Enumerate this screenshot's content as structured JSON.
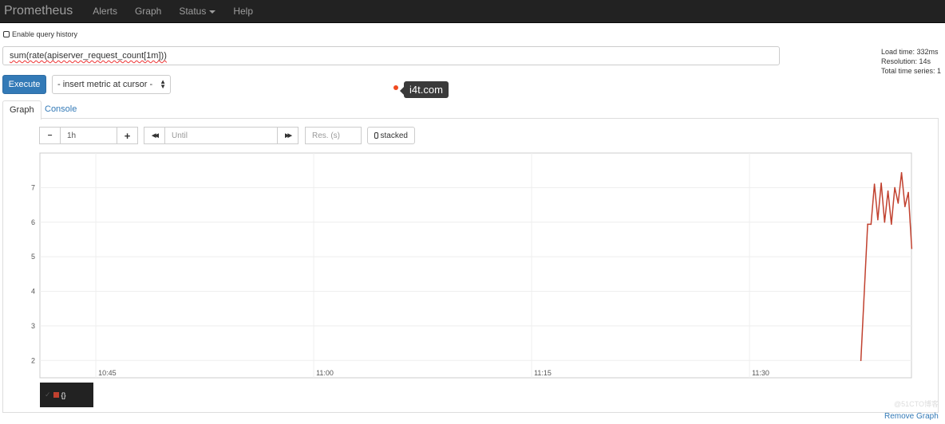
{
  "nav": {
    "brand": "Prometheus",
    "items": [
      "Alerts",
      "Graph",
      "Status",
      "Help"
    ]
  },
  "query_history_label": "Enable query history",
  "expression": "sum(rate(apiserver_request_count[1m]))",
  "stats": {
    "load_time": "Load time: 332ms",
    "resolution": "Resolution: 14s",
    "total_series": "Total time series: 1"
  },
  "execute_label": "Execute",
  "metric_select": "- insert metric at cursor -",
  "tooltip": "i4t.com",
  "tabs": [
    "Graph",
    "Console"
  ],
  "controls": {
    "minus": "−",
    "range": "1h",
    "plus": "+",
    "back": "◀◀",
    "until_placeholder": "Until",
    "forward": "▶▶",
    "res_placeholder": "Res. (s)",
    "stacked": "stacked"
  },
  "legend": {
    "check": "✓",
    "label": "{}"
  },
  "remove_graph": "Remove Graph",
  "watermark": "@51CTO博客",
  "chart_data": {
    "type": "line",
    "xlim": [
      "10:41:09",
      "11:41:09"
    ],
    "ylim": [
      1.5,
      8
    ],
    "x_ticks": [
      "10:45",
      "11:00",
      "11:15",
      "11:30"
    ],
    "y_ticks": [
      2,
      3,
      4,
      5,
      6,
      7
    ],
    "grid": true,
    "line_color": "#c1412f",
    "series": [
      {
        "name": "{}",
        "x": [
          "11:37:40",
          "11:38:08",
          "11:38:22",
          "11:38:36",
          "11:38:50",
          "11:39:04",
          "11:39:18",
          "11:39:32",
          "11:39:46",
          "11:40:00",
          "11:40:14",
          "11:40:28",
          "11:40:42",
          "11:40:56",
          "11:41:10"
        ],
        "values": [
          2.0,
          5.94,
          5.94,
          7.1,
          6.07,
          7.13,
          6.0,
          6.9,
          5.94,
          7.0,
          6.55,
          7.43,
          6.45,
          6.86,
          5.24
        ]
      }
    ]
  }
}
